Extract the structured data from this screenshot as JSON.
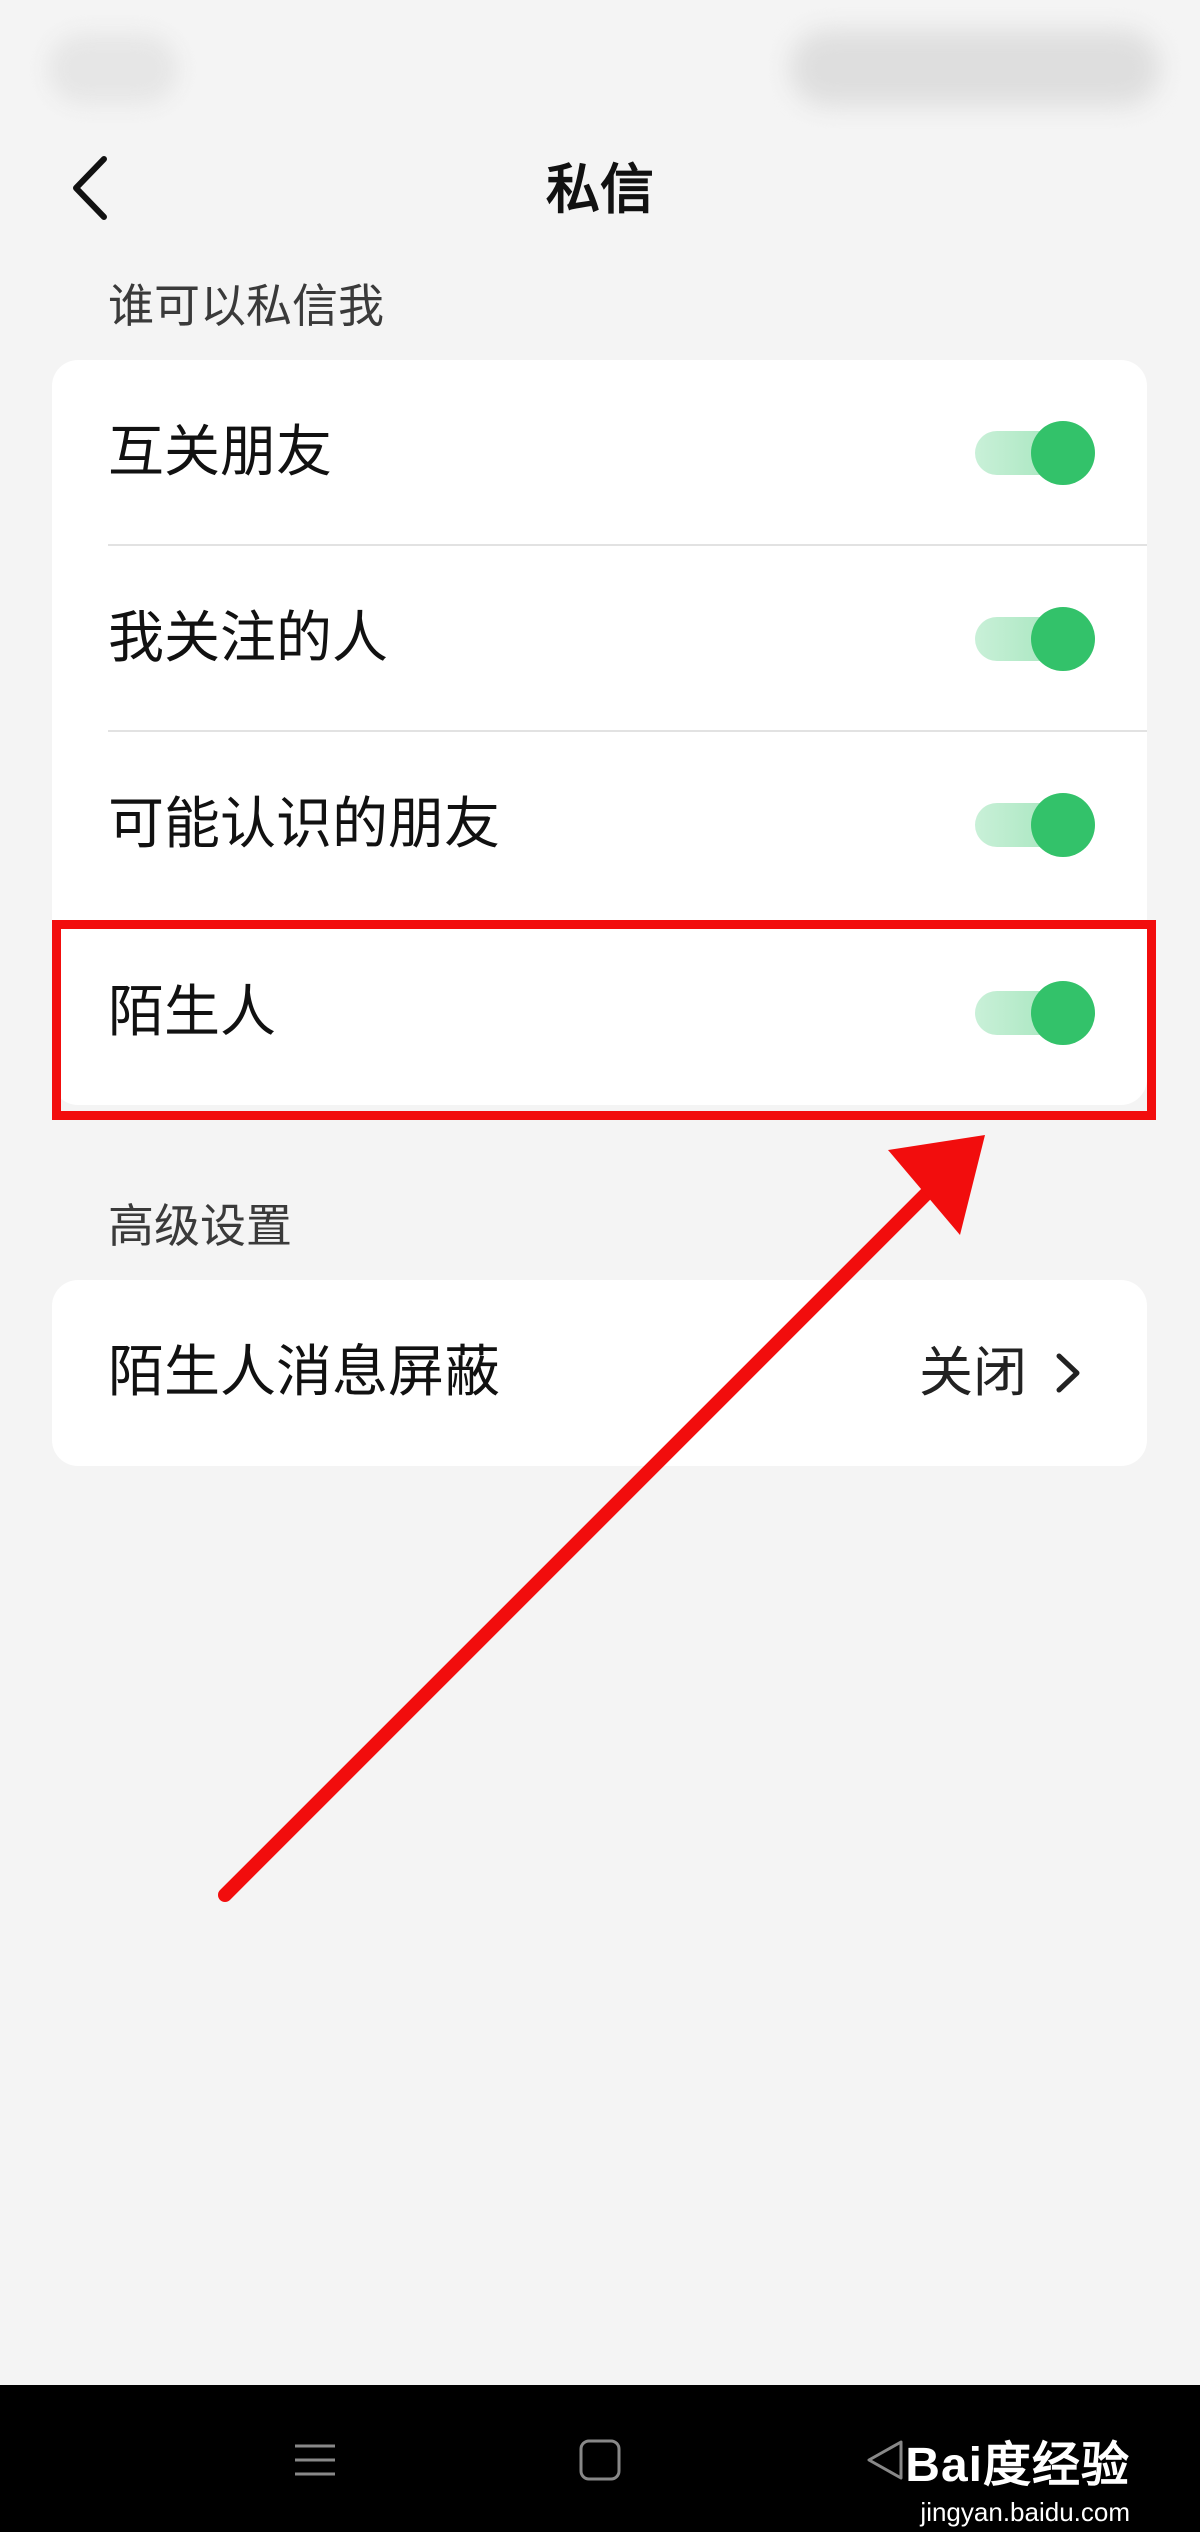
{
  "header": {
    "title": "私信"
  },
  "who_can_message": {
    "section_label": "谁可以私信我",
    "items": [
      {
        "label": "互关朋友",
        "enabled": true
      },
      {
        "label": "我关注的人",
        "enabled": true
      },
      {
        "label": "可能认识的朋友",
        "enabled": true
      },
      {
        "label": "陌生人",
        "enabled": true
      }
    ]
  },
  "advanced": {
    "section_label": "高级设置",
    "stranger_block": {
      "label": "陌生人消息屏蔽",
      "value": "关闭"
    }
  },
  "watermark": {
    "brand": "Bai度经验",
    "url": "jingyan.baidu.com"
  },
  "colors": {
    "toggle_on": "#33c26a",
    "annotation": "#f20d0d",
    "background": "#f4f4f4"
  },
  "icons": [
    "back-arrow-icon",
    "chevron-right-icon",
    "menu-icon",
    "home-icon",
    "back-triangle-icon"
  ]
}
